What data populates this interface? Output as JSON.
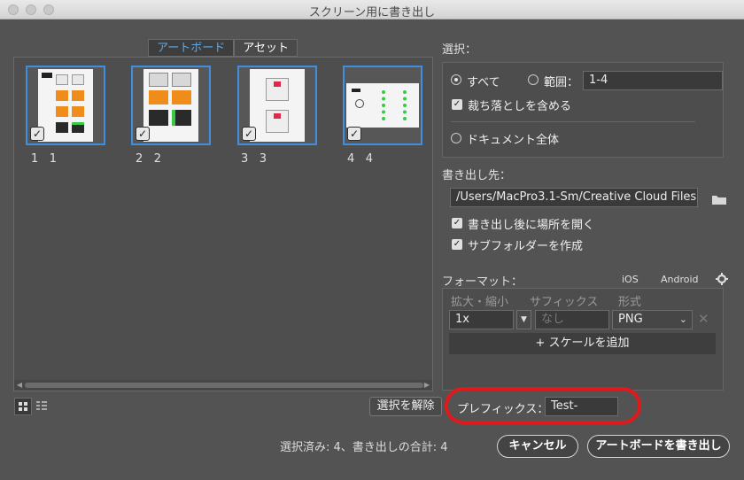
{
  "window": {
    "title": "スクリーン用に書き出し"
  },
  "tabs": {
    "artboard": "アートボード",
    "asset": "アセット"
  },
  "artboards": [
    {
      "num": "1",
      "name": "1"
    },
    {
      "num": "2",
      "name": "2"
    },
    {
      "num": "3",
      "name": "3"
    },
    {
      "num": "4",
      "name": "4"
    }
  ],
  "selection": {
    "label": "選択：",
    "all": "すべて",
    "range": "範囲：",
    "range_value": "1-4",
    "include_bleed": "裁ち落としを含める",
    "whole_document": "ドキュメント全体"
  },
  "export_to": {
    "label": "書き出し先：",
    "path": "/Users/MacPro3.1-Sm/Creative Cloud Files",
    "open_after": "書き出し後に場所を開く",
    "create_subfolders": "サブフォルダーを作成"
  },
  "format": {
    "label": "フォーマット：",
    "ios": "iOS",
    "android": "Android",
    "col_scale": "拡大・縮小",
    "col_suffix": "サフィックス",
    "col_format": "形式",
    "scale_value": "1x",
    "suffix_placeholder": "なし",
    "format_value": "PNG",
    "add_scale": "+ スケールを追加"
  },
  "footer": {
    "deselect": "選択を解除",
    "prefix_label": "プレフィックス：",
    "prefix_value": "Test-",
    "status": "選択済み: 4、書き出しの合計: 4",
    "cancel": "キャンセル",
    "export": "アートボードを書き出し"
  },
  "colors": {
    "accent": "#3e8fe0",
    "highlight_ring": "#e0191b",
    "background": "#535353"
  }
}
